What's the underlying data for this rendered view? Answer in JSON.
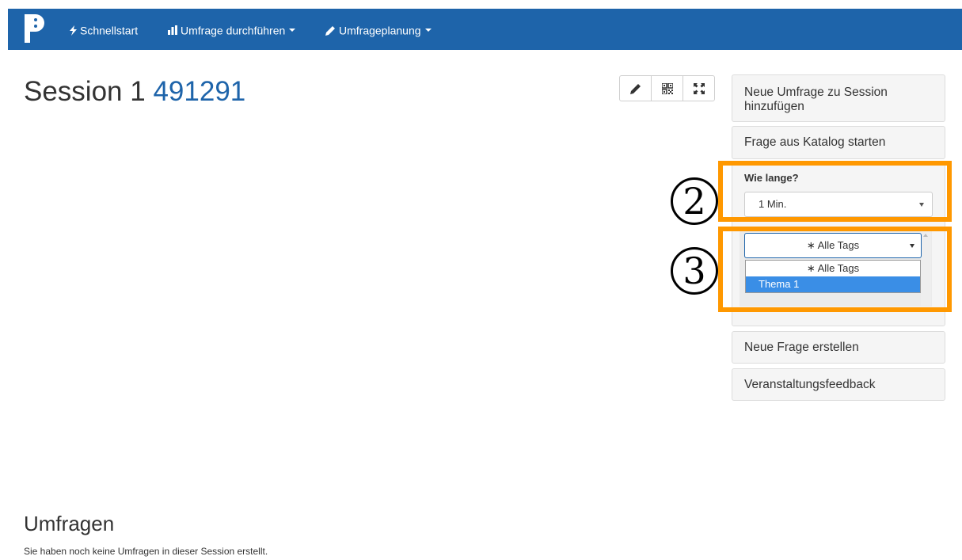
{
  "navbar": {
    "bg_color": "#1e64aa",
    "logo_icon": "pingo-logo",
    "items": [
      {
        "label": "Schnellstart",
        "icon": "bolt-icon"
      },
      {
        "label": "Umfrage durchführen",
        "icon": "bar-chart-icon",
        "has_dropdown": true
      },
      {
        "label": "Umfrageplanung",
        "icon": "pencil-icon",
        "has_dropdown": true
      }
    ]
  },
  "page": {
    "title": "Session 1",
    "session_code": "491291"
  },
  "toolbar": {
    "icons": [
      "pencil-icon",
      "qr-code-icon",
      "fullscreen-icon"
    ]
  },
  "sidebar": {
    "add_survey_label": "Neue Umfrage zu Session hinzufügen",
    "start_from_catalog_label": "Frage aus Katalog starten",
    "duration_label": "Wie lange?",
    "duration_value": "1 Min.",
    "tags_value": "∗ Alle Tags",
    "tags_options": [
      "∗ Alle Tags",
      "Thema 1"
    ],
    "tags_selected_option": "Thema 1",
    "new_question_label": "Neue Frage erstellen",
    "feedback_label": "Veranstaltungsfeedback"
  },
  "annotations": {
    "step2": "②",
    "step3": "③",
    "highlight_color": "#ff9800"
  },
  "surveys": {
    "title": "Umfragen",
    "empty_text": "Sie haben noch keine Umfragen in dieser Session erstellt."
  }
}
